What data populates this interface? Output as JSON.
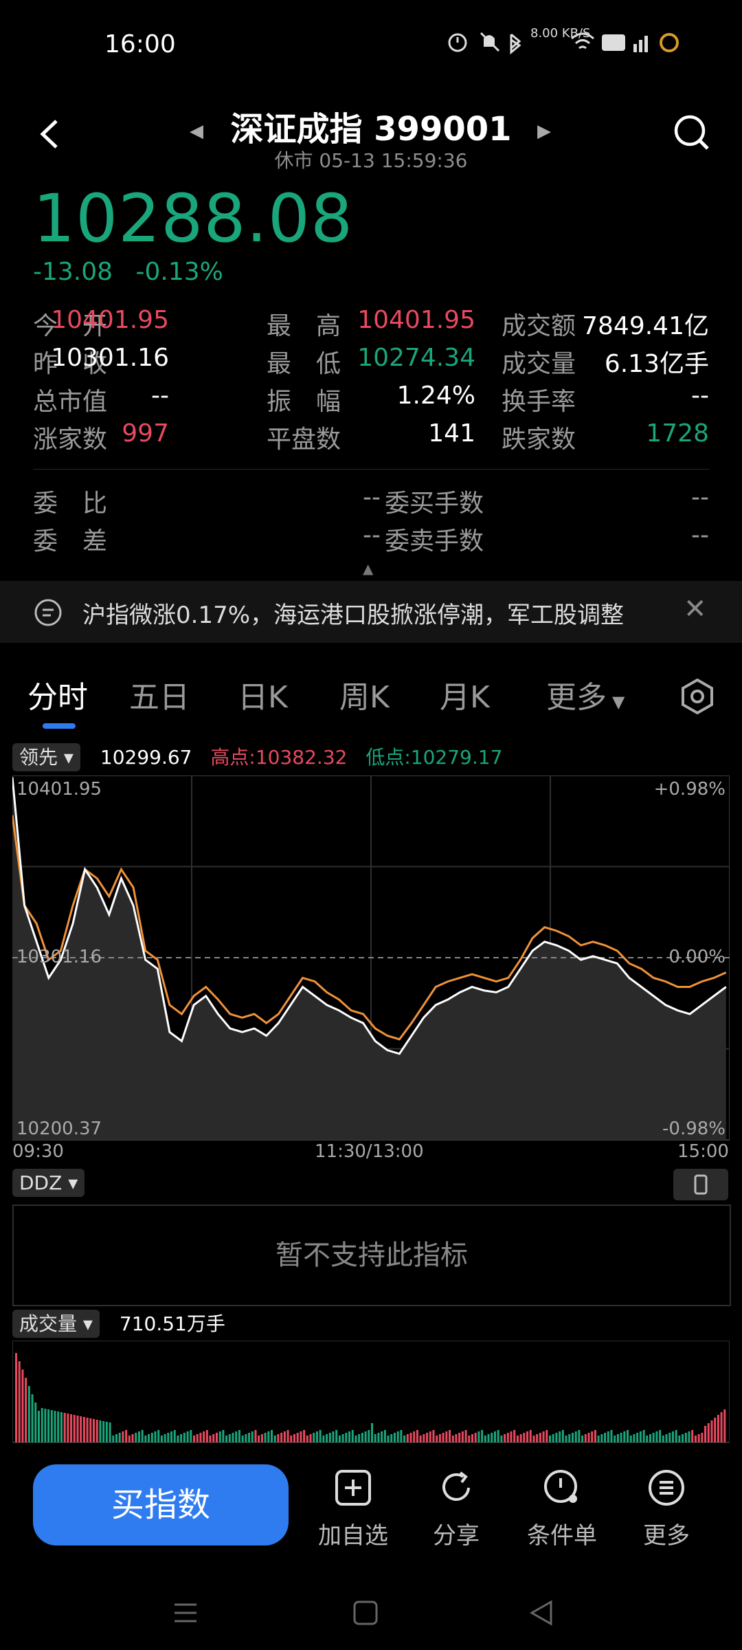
{
  "status_bar": {
    "time": "16:00",
    "net_speed": "8.00 KB/S",
    "icons": [
      "alarm-icon",
      "mute-icon",
      "bluetooth-icon",
      "wifi-icon",
      "hd-icon",
      "signal-4g-icon",
      "signal-5g-icon",
      "battery-icon"
    ]
  },
  "header": {
    "title": "深证成指 399001",
    "subtitle": "休市 05-13 15:59:36"
  },
  "quote": {
    "price": "10288.08",
    "change": "-13.08",
    "change_pct": "-0.13%",
    "rows": [
      [
        {
          "label": "今　开",
          "value": "10401.95",
          "color": "red"
        },
        {
          "label": "最　高",
          "value": "10401.95",
          "color": "red"
        },
        {
          "label": "成交额",
          "value": "7849.41亿",
          "color": "white"
        }
      ],
      [
        {
          "label": "昨　收",
          "value": "10301.16",
          "color": "white"
        },
        {
          "label": "最　低",
          "value": "10274.34",
          "color": "green"
        },
        {
          "label": "成交量",
          "value": "6.13亿手",
          "color": "white"
        }
      ],
      [
        {
          "label": "总市值",
          "value": "--",
          "color": "white"
        },
        {
          "label": "振　幅",
          "value": "1.24%",
          "color": "white"
        },
        {
          "label": "换手率",
          "value": "--",
          "color": "white"
        }
      ],
      [
        {
          "label": "涨家数",
          "value": "997",
          "color": "red"
        },
        {
          "label": "平盘数",
          "value": "141",
          "color": "white"
        },
        {
          "label": "跌家数",
          "value": "1728",
          "color": "green"
        }
      ]
    ],
    "order_rows": [
      [
        {
          "label": "委　比",
          "value": "--"
        },
        {
          "label": "委买手数",
          "value": "--"
        }
      ],
      [
        {
          "label": "委　差",
          "value": "--"
        },
        {
          "label": "委卖手数",
          "value": "--"
        }
      ]
    ]
  },
  "news": {
    "text": "沪指微涨0.17%，海运港口股掀涨停潮，军工股调整"
  },
  "tabs": [
    "分时",
    "五日",
    "日K",
    "周K",
    "月K",
    "更多"
  ],
  "active_tab": 0,
  "chart_header": {
    "dropdown": "领先",
    "value": "10299.67",
    "high": "高点:10382.32",
    "low": "低点:10279.17"
  },
  "chart_data": {
    "type": "line",
    "y_left_ticks": [
      "10401.95",
      "10301.16",
      "10200.37"
    ],
    "y_right_ticks": [
      "+0.98%",
      "0.00%",
      "-0.98%"
    ],
    "x_ticks": [
      "09:30",
      "11:30/13:00",
      "15:00"
    ],
    "ylim": [
      10200.37,
      10401.95
    ],
    "baseline": 10301.16,
    "series": [
      {
        "color": "#ffffff",
        "values": [
          10401,
          10330,
          10310,
          10290,
          10300,
          10320,
          10350,
          10340,
          10325,
          10345,
          10330,
          10300,
          10295,
          10260,
          10255,
          10275,
          10280,
          10270,
          10262,
          10260,
          10262,
          10258,
          10265,
          10275,
          10285,
          10280,
          10275,
          10272,
          10268,
          10265,
          10255,
          10250,
          10248,
          10258,
          10268,
          10275,
          10278,
          10282,
          10285,
          10283,
          10282,
          10285,
          10295,
          10305,
          10310,
          10308,
          10305,
          10300,
          10302,
          10300,
          10298,
          10290,
          10285,
          10280,
          10275,
          10272,
          10270,
          10275,
          10280,
          10285
        ]
      },
      {
        "color": "#f0923a",
        "values": [
          10380,
          10330,
          10320,
          10300,
          10305,
          10330,
          10350,
          10345,
          10335,
          10350,
          10340,
          10305,
          10300,
          10275,
          10270,
          10280,
          10285,
          10278,
          10270,
          10268,
          10270,
          10265,
          10270,
          10280,
          10290,
          10288,
          10282,
          10278,
          10272,
          10270,
          10262,
          10258,
          10256,
          10265,
          10275,
          10285,
          10288,
          10290,
          10292,
          10290,
          10288,
          10290,
          10300,
          10312,
          10318,
          10316,
          10313,
          10308,
          10310,
          10308,
          10305,
          10298,
          10295,
          10290,
          10288,
          10285,
          10285,
          10288,
          10290,
          10293
        ]
      }
    ]
  },
  "ddz": {
    "label": "DDZ",
    "message": "暂不支持此指标"
  },
  "volume": {
    "label": "成交量",
    "value": "710.51万手"
  },
  "bottom_bar": {
    "buy": "买指数",
    "actions": [
      {
        "label": "加自选",
        "icon": "add-square-icon"
      },
      {
        "label": "分享",
        "icon": "share-icon"
      },
      {
        "label": "条件单",
        "icon": "clock-order-icon"
      },
      {
        "label": "更多",
        "icon": "menu-icon"
      }
    ]
  }
}
